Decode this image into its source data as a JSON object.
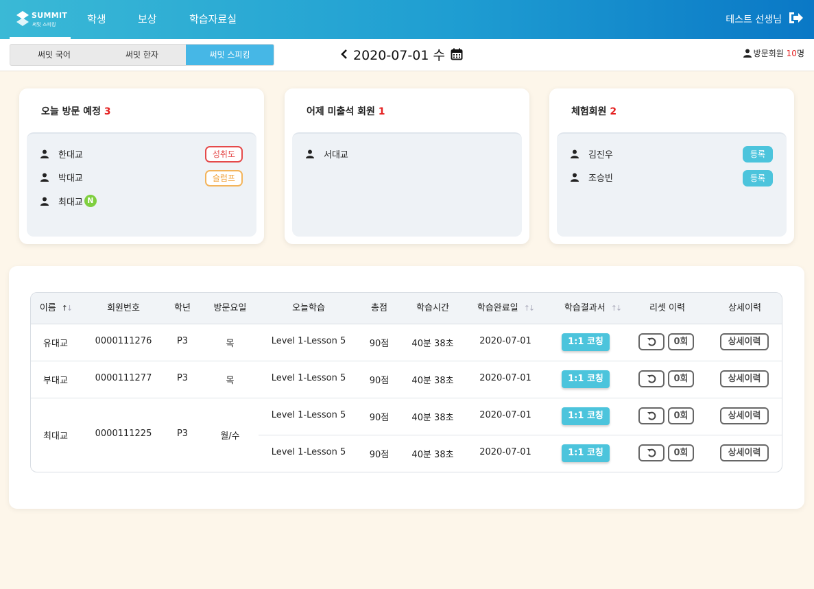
{
  "header": {
    "brand": "SUMMIT",
    "brand_sub": "써밋 스피킹",
    "nav": [
      "학생",
      "보상",
      "학습자료실"
    ],
    "user": "테스트 선생님"
  },
  "subbar": {
    "tabs": [
      "써밋 국어",
      "써밋 한자",
      "써밋 스피킹"
    ],
    "active_tab": "써밋 스피킹",
    "date": "2020-07-01 수",
    "visit_label": "방문회원",
    "visit_count": "10",
    "visit_unit": "명"
  },
  "cards": [
    {
      "title": "오늘 방문 예정",
      "count": "3",
      "members": [
        {
          "name": "한대교",
          "tag": "성취도"
        },
        {
          "name": "박대교",
          "tag": "슬럼프"
        },
        {
          "name": "최대교",
          "badge": "N"
        }
      ]
    },
    {
      "title": "어제 미출석 회원",
      "count": "1",
      "members": [
        {
          "name": "서대교"
        }
      ]
    },
    {
      "title": "체험회원",
      "count": "2",
      "members": [
        {
          "name": "김진우",
          "tag": "등록"
        },
        {
          "name": "조승빈",
          "tag": "등록"
        }
      ]
    }
  ],
  "table": {
    "headers": [
      "이름",
      "회원번호",
      "학년",
      "방문요일",
      "오늘학습",
      "총점",
      "학습시간",
      "학습완료일",
      "학습결과서",
      "리셋 이력",
      "상세이력"
    ],
    "rows": [
      {
        "name": "유대교",
        "id": "0000111276",
        "grade": "P3",
        "day": "목",
        "lesson": "Level 1-Lesson 5",
        "score": "90점",
        "time": "40분 38초",
        "date": "2020-07-01",
        "result": "1:1 코칭",
        "reset": "0회",
        "detail": "상세이력"
      },
      {
        "name": "부대교",
        "id": "0000111277",
        "grade": "P3",
        "day": "목",
        "lesson": "Level 1-Lesson 5",
        "score": "90점",
        "time": "40분 38초",
        "date": "2020-07-01",
        "result": "1:1 코칭",
        "reset": "0회",
        "detail": "상세이력"
      },
      {
        "name": "최대교",
        "id": "0000111225",
        "grade": "P3",
        "day": "월/수",
        "lesson": "Level 1-Lesson 5",
        "score": "90점",
        "time": "40분 38초",
        "date": "2020-07-01",
        "result": "1:1 코칭",
        "reset": "0회",
        "detail": "상세이력"
      },
      {
        "lesson": "Level 1-Lesson 5",
        "score": "90점",
        "time": "40분 38초",
        "date": "2020-07-01",
        "result": "1:1 코칭",
        "reset": "0회",
        "detail": "상세이력"
      }
    ]
  },
  "colors": {
    "accent": "#46b7e6",
    "coach": "#4cc4dc",
    "count_red": "#e41f1f",
    "background": "#fdf6ea"
  }
}
